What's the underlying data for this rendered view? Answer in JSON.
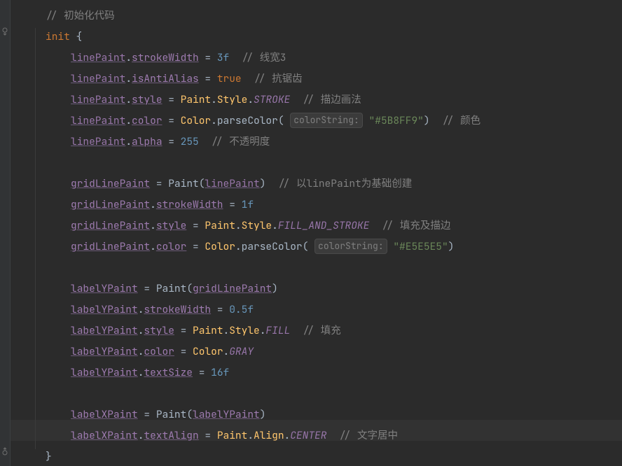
{
  "comment_init": "// 初始化代码",
  "init_kw": "init",
  "brace_open": " {",
  "brace_close": "}",
  "linePaint": "linePaint",
  "gridLinePaint": "gridLinePaint",
  "labelYPaint": "labelYPaint",
  "labelXPaint": "labelXPaint",
  "prop": {
    "strokeWidth": "strokeWidth",
    "isAntiAlias": "isAntiAlias",
    "style": "style",
    "color": "color",
    "alpha": "alpha",
    "textSize": "textSize",
    "textAlign": "textAlign"
  },
  "eq": " = ",
  "val": {
    "threef": "3f",
    "true": "true",
    "onef": "1f",
    "halff": "0.5f",
    "n255": "255",
    "n16f": "16f"
  },
  "cls": {
    "Paint": "Paint",
    "Style": "Style",
    "Color": "Color",
    "Align": "Align"
  },
  "en": {
    "STROKE": "STROKE",
    "FILL_AND_STROKE": "FILL_AND_STROKE",
    "FILL": "FILL",
    "GRAY": "GRAY",
    "CENTER": "CENTER"
  },
  "call": {
    "parseColor": "parseColor",
    "PaintCtor": "Paint"
  },
  "hint": {
    "colorString": "colorString:"
  },
  "str": {
    "blue": "\"#5B8FF9\"",
    "grey": "\"#E5E5E5\""
  },
  "cmt": {
    "lw3": "// 线宽3",
    "aa": "// 抗锯齿",
    "strokeMode": "// 描边画法",
    "colorLbl": "// 颜色",
    "opacity": "// 不透明度",
    "fromLine": "// 以linePaint为基础创建",
    "fillStroke": "// 填充及描边",
    "fill": "// 填充",
    "center": "// 文字居中"
  },
  "punct": {
    "dot": ".",
    "lparen": "(",
    "rparen": ")"
  }
}
